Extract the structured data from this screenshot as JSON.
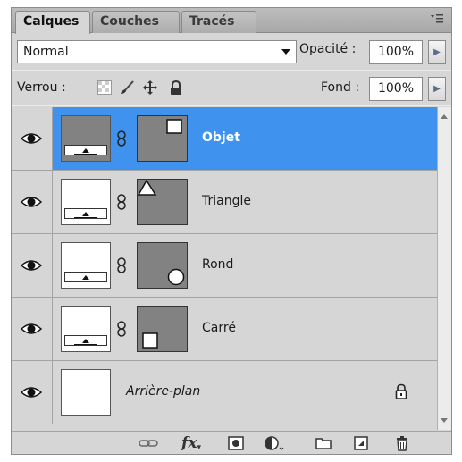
{
  "tabs": [
    {
      "label": "Calques",
      "active": true
    },
    {
      "label": "Couches",
      "active": false
    },
    {
      "label": "Tracés",
      "active": false
    }
  ],
  "panel_menu_icon": "panel-menu-icon",
  "blend": {
    "mode": "Normal",
    "opacity_label": "Opacité :",
    "opacity_value": "100%"
  },
  "lock": {
    "label": "Verrou :",
    "icons": [
      "lock-transparent-pixels-icon",
      "lock-image-pixels-icon",
      "lock-position-icon",
      "lock-all-icon"
    ],
    "fill_label": "Fond :",
    "fill_value": "100%"
  },
  "layers": [
    {
      "name": "Objet",
      "selected": true,
      "visible": true,
      "thumb": "gray",
      "mask_shape": "square-top-right"
    },
    {
      "name": "Triangle",
      "selected": false,
      "visible": true,
      "thumb": "white",
      "mask_shape": "triangle-top-left"
    },
    {
      "name": "Rond",
      "selected": false,
      "visible": true,
      "thumb": "white",
      "mask_shape": "circle-bottom-right"
    },
    {
      "name": "Carré",
      "selected": false,
      "visible": true,
      "thumb": "white",
      "mask_shape": "square-bottom-left"
    },
    {
      "name": "Arrière-plan",
      "selected": false,
      "visible": true,
      "thumb": "white",
      "locked": true,
      "background": true
    }
  ],
  "toolbar": {
    "icons": [
      "link-layers-icon",
      "layer-style-fx-icon",
      "add-mask-icon",
      "adjustment-layer-icon",
      "new-group-icon",
      "new-layer-icon",
      "delete-layer-icon"
    ],
    "fx_label": "fx"
  },
  "colors": {
    "selection": "#3f93ee",
    "panel": "#d6d6d6",
    "mask_gray": "#828282"
  }
}
